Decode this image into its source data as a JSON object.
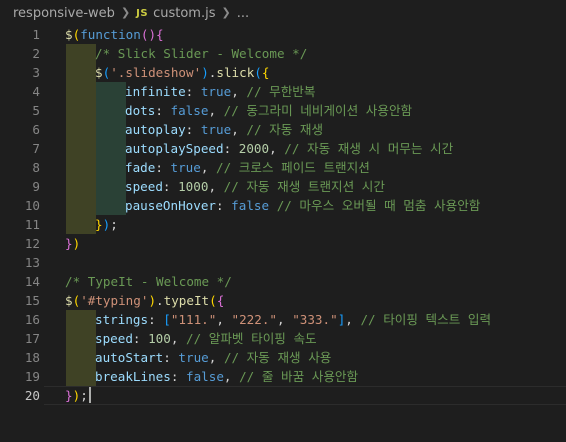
{
  "breadcrumb": {
    "folder": "responsive-web",
    "file_icon": "JS",
    "file": "custom.js",
    "more": "..."
  },
  "editor": {
    "active_line": 20,
    "lines": [
      {
        "num": "1",
        "tokens": [
          [
            "fn",
            "$"
          ],
          [
            "p1",
            "("
          ],
          [
            "kw",
            "function"
          ],
          [
            "p2",
            "()"
          ],
          [
            "p2",
            "{"
          ]
        ]
      },
      {
        "num": "2",
        "tokens": [
          [
            "com",
            "/* Slick Slider - Welcome */"
          ]
        ]
      },
      {
        "num": "3",
        "tokens": [
          [
            "fn",
            "$"
          ],
          [
            "p3",
            "("
          ],
          [
            "str",
            "'.slideshow'"
          ],
          [
            "p3",
            ")"
          ],
          [
            "pun",
            "."
          ],
          [
            "fn",
            "slick"
          ],
          [
            "p3",
            "("
          ],
          [
            "p1",
            "{"
          ]
        ]
      },
      {
        "num": "4",
        "tokens": [
          [
            "key",
            "infinite"
          ],
          [
            "pun",
            ": "
          ],
          [
            "kw",
            "true"
          ],
          [
            "pun",
            ", "
          ],
          [
            "com",
            "// 무한반복"
          ]
        ]
      },
      {
        "num": "5",
        "tokens": [
          [
            "key",
            "dots"
          ],
          [
            "pun",
            ": "
          ],
          [
            "kw",
            "false"
          ],
          [
            "pun",
            ", "
          ],
          [
            "com",
            "// 동그라미 네비게이션 사용안함"
          ]
        ]
      },
      {
        "num": "6",
        "tokens": [
          [
            "key",
            "autoplay"
          ],
          [
            "pun",
            ": "
          ],
          [
            "kw",
            "true"
          ],
          [
            "pun",
            ", "
          ],
          [
            "com",
            "// 자동 재생"
          ]
        ]
      },
      {
        "num": "7",
        "tokens": [
          [
            "key",
            "autoplaySpeed"
          ],
          [
            "pun",
            ": "
          ],
          [
            "num",
            "2000"
          ],
          [
            "pun",
            ", "
          ],
          [
            "com",
            "// 자동 재생 시 머무는 시간"
          ]
        ]
      },
      {
        "num": "8",
        "tokens": [
          [
            "key",
            "fade"
          ],
          [
            "pun",
            ": "
          ],
          [
            "kw",
            "true"
          ],
          [
            "pun",
            ", "
          ],
          [
            "com",
            "// 크로스 페이드 트랜지션"
          ]
        ]
      },
      {
        "num": "9",
        "tokens": [
          [
            "key",
            "speed"
          ],
          [
            "pun",
            ": "
          ],
          [
            "num",
            "1000"
          ],
          [
            "pun",
            ", "
          ],
          [
            "com",
            "// 자동 재생 트랜지션 시간"
          ]
        ]
      },
      {
        "num": "10",
        "tokens": [
          [
            "key",
            "pauseOnHover"
          ],
          [
            "pun",
            ": "
          ],
          [
            "kw",
            "false"
          ],
          [
            "pun",
            " "
          ],
          [
            "com",
            "// 마우스 오버될 때 멈춤 사용안함"
          ]
        ]
      },
      {
        "num": "11",
        "tokens": [
          [
            "p1",
            "}"
          ],
          [
            "p3",
            ")"
          ],
          [
            "pun",
            ";"
          ]
        ]
      },
      {
        "num": "12",
        "tokens": [
          [
            "p2",
            "}"
          ],
          [
            "p1",
            ")"
          ]
        ]
      },
      {
        "num": "13",
        "tokens": []
      },
      {
        "num": "14",
        "tokens": [
          [
            "com",
            "/* TypeIt - Welcome */"
          ]
        ]
      },
      {
        "num": "15",
        "tokens": [
          [
            "fn",
            "$"
          ],
          [
            "p1",
            "("
          ],
          [
            "str",
            "'#typing'"
          ],
          [
            "p1",
            ")"
          ],
          [
            "pun",
            "."
          ],
          [
            "fn",
            "typeIt"
          ],
          [
            "p1",
            "("
          ],
          [
            "p2",
            "{"
          ]
        ]
      },
      {
        "num": "16",
        "tokens": [
          [
            "key",
            "strings"
          ],
          [
            "pun",
            ": "
          ],
          [
            "p3",
            "["
          ],
          [
            "str",
            "\"111.\""
          ],
          [
            "pun",
            ", "
          ],
          [
            "str",
            "\"222.\""
          ],
          [
            "pun",
            ", "
          ],
          [
            "str",
            "\"333.\""
          ],
          [
            "p3",
            "]"
          ],
          [
            "pun",
            ", "
          ],
          [
            "com",
            "// 타이핑 텍스트 입력"
          ]
        ]
      },
      {
        "num": "17",
        "tokens": [
          [
            "key",
            "speed"
          ],
          [
            "pun",
            ": "
          ],
          [
            "num",
            "100"
          ],
          [
            "pun",
            ", "
          ],
          [
            "com",
            "// 알파벳 타이핑 속도"
          ]
        ]
      },
      {
        "num": "18",
        "tokens": [
          [
            "key",
            "autoStart"
          ],
          [
            "pun",
            ": "
          ],
          [
            "kw",
            "true"
          ],
          [
            "pun",
            ", "
          ],
          [
            "com",
            "// 자동 재생 사용"
          ]
        ]
      },
      {
        "num": "19",
        "tokens": [
          [
            "key",
            "breakLines"
          ],
          [
            "pun",
            ": "
          ],
          [
            "kw",
            "false"
          ],
          [
            "pun",
            ", "
          ],
          [
            "com",
            "// 줄 바꿈 사용안함"
          ]
        ]
      },
      {
        "num": "20",
        "tokens": [
          [
            "p2",
            "}"
          ],
          [
            "p1",
            ")"
          ],
          [
            "pun",
            ";"
          ]
        ]
      }
    ]
  }
}
